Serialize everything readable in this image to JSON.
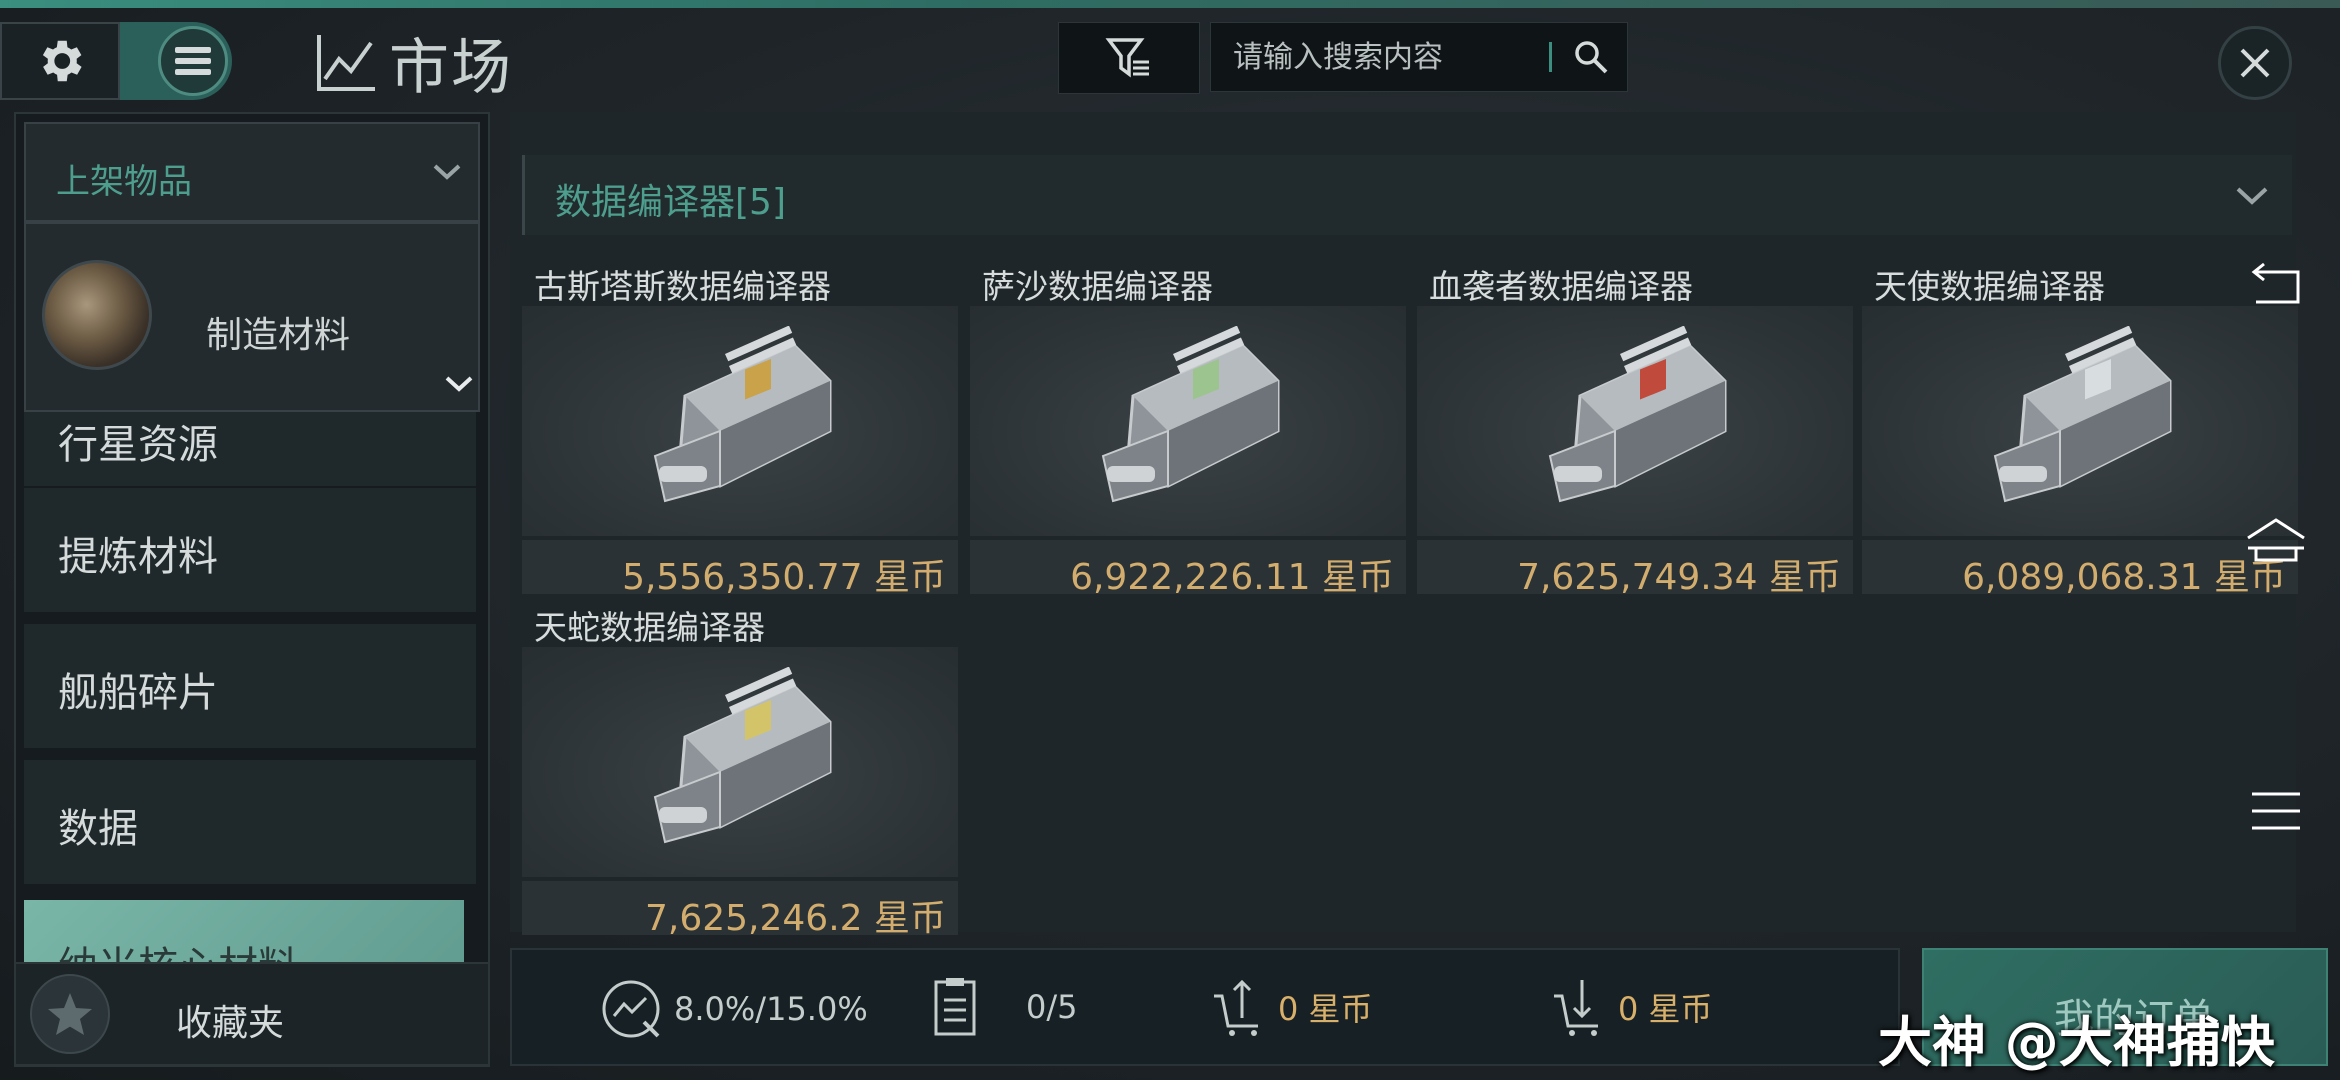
{
  "header": {
    "title": "市场",
    "search_placeholder": "请输入搜索内容"
  },
  "sidebar": {
    "listing_dropdown": "上架物品",
    "category_dropdown": "制造材料",
    "items": [
      {
        "label": "行星资源",
        "selected": false
      },
      {
        "label": "提炼材料",
        "selected": false
      },
      {
        "label": "舰船碎片",
        "selected": false
      },
      {
        "label": "数据",
        "selected": false
      },
      {
        "label": "纳米核心材料",
        "selected": true
      }
    ],
    "favorites": "收藏夹"
  },
  "section": {
    "title": "数据编译器[5]"
  },
  "items": [
    {
      "name": "古斯塔斯数据编译器",
      "price": "5,556,350.77 星币",
      "accent": "#c9a24a"
    },
    {
      "name": "萨沙数据编译器",
      "price": "6,922,226.11 星币",
      "accent": "#9cc48e"
    },
    {
      "name": "血袭者数据编译器",
      "price": "7,625,749.34 星币",
      "accent": "#c04a3c"
    },
    {
      "name": "天使数据编译器",
      "price": "6,089,068.31 星币",
      "accent": "#d8dde0"
    },
    {
      "name": "天蛇数据编译器",
      "price": "7,625,246.2 星币",
      "accent": "#d3c46a"
    }
  ],
  "bottom": {
    "tax": "8.0%/15.0%",
    "orders": "0/5",
    "sell_amount": "0 星币",
    "buy_amount": "0 星币",
    "my_orders": "我的订单"
  },
  "watermark": "大神 @大神捕快",
  "colors": {
    "accent_teal": "#4e9e8e",
    "price_gold": "#d3ad6e"
  }
}
